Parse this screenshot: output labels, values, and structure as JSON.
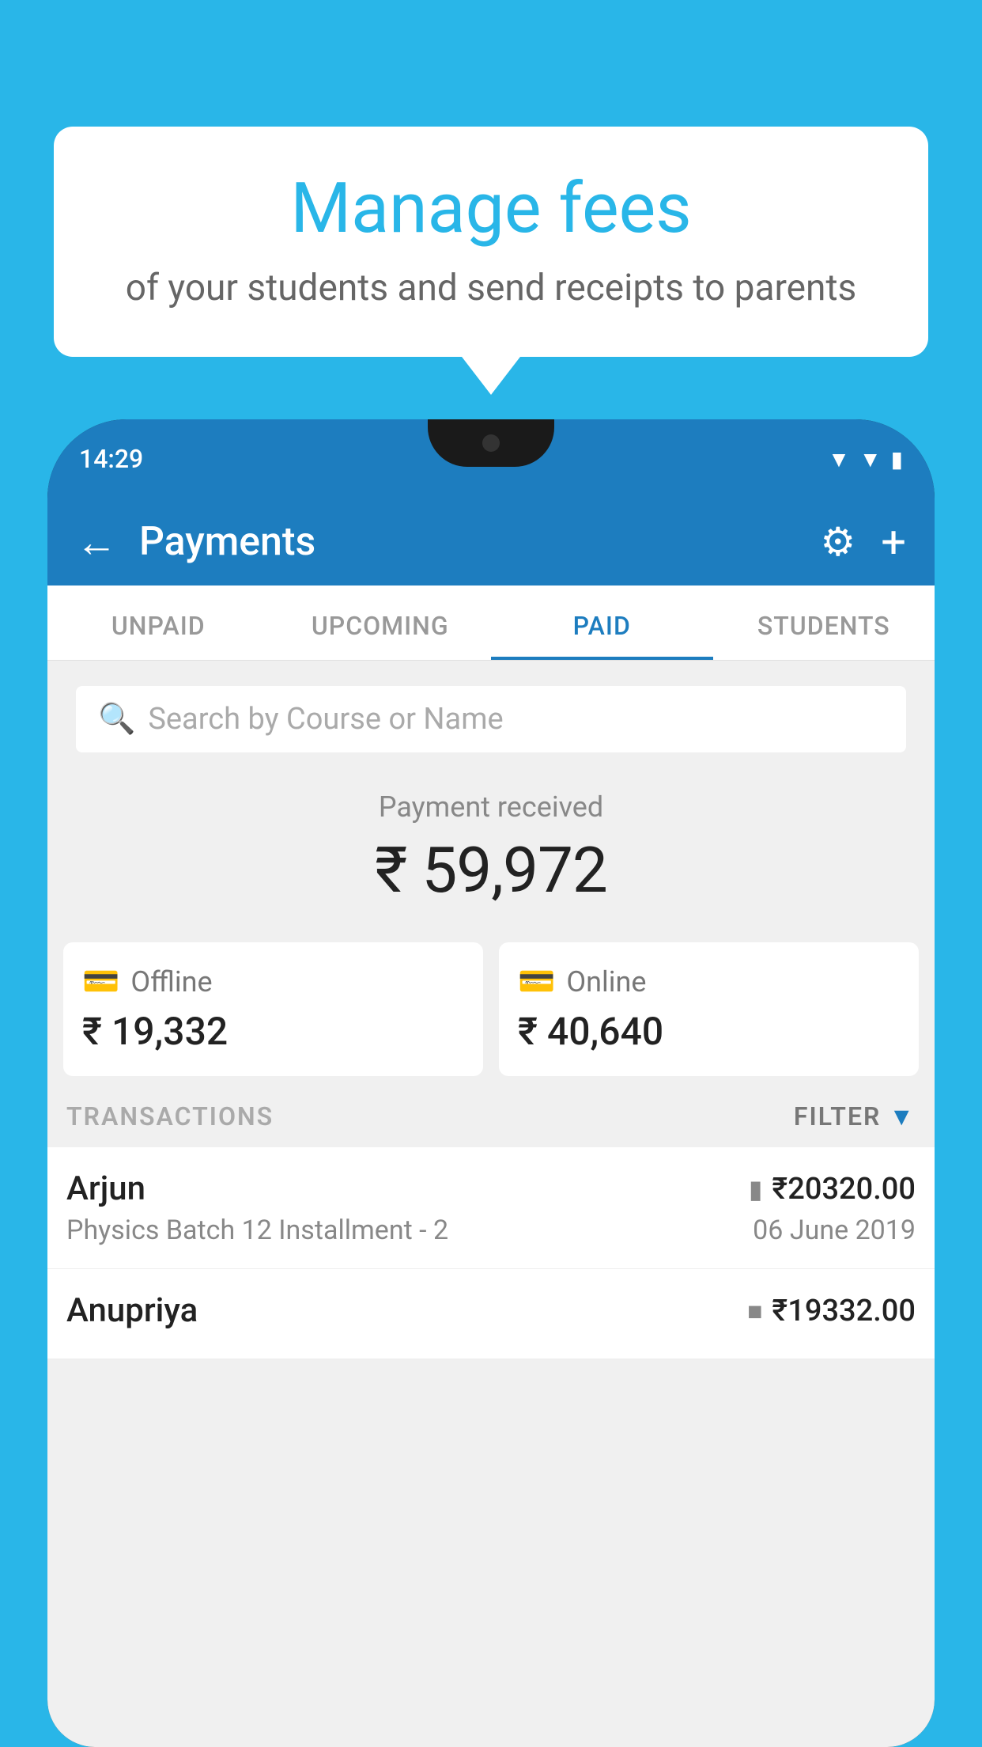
{
  "background_color": "#29b6e8",
  "bubble": {
    "title": "Manage fees",
    "subtitle": "of your students and send receipts to parents"
  },
  "status_bar": {
    "time": "14:29",
    "wifi": "▲",
    "signal": "▲",
    "battery": "▪"
  },
  "header": {
    "title": "Payments",
    "back_icon": "←",
    "gear_icon": "⚙",
    "plus_icon": "+"
  },
  "tabs": [
    {
      "label": "UNPAID",
      "active": false
    },
    {
      "label": "UPCOMING",
      "active": false
    },
    {
      "label": "PAID",
      "active": true
    },
    {
      "label": "STUDENTS",
      "active": false
    }
  ],
  "search": {
    "placeholder": "Search by Course or Name"
  },
  "payment_summary": {
    "label": "Payment received",
    "amount": "₹ 59,972"
  },
  "payment_cards": [
    {
      "label": "Offline",
      "amount": "₹ 19,332",
      "icon": "offline"
    },
    {
      "label": "Online",
      "amount": "₹ 40,640",
      "icon": "online"
    }
  ],
  "transactions": {
    "label": "TRANSACTIONS",
    "filter_label": "FILTER"
  },
  "transaction_rows": [
    {
      "name": "Arjun",
      "amount": "₹20320.00",
      "course": "Physics Batch 12 Installment - 2",
      "date": "06 June 2019",
      "type": "online"
    },
    {
      "name": "Anupriya",
      "amount": "₹19332.00",
      "course": "",
      "date": "",
      "type": "offline"
    }
  ]
}
